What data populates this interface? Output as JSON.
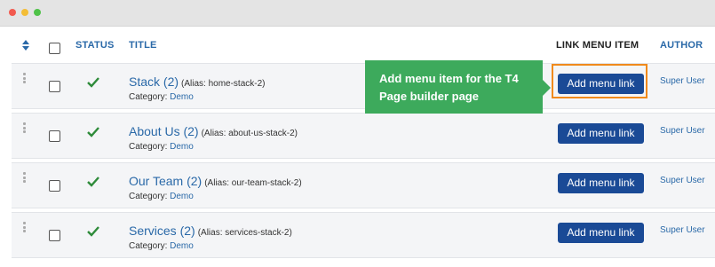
{
  "window": {
    "controls": [
      "close",
      "minimize",
      "maximize"
    ]
  },
  "table": {
    "headers": {
      "status": "STATUS",
      "title": "TITLE",
      "link_menu_item": "LINK MENU ITEM",
      "author": "AUTHOR"
    },
    "rows": [
      {
        "title": "Stack (2)",
        "alias": "(Alias: home-stack-2)",
        "category_label": "Category:",
        "category": "Demo",
        "button": "Add menu link",
        "author": "Super User",
        "status": "published"
      },
      {
        "title": "About Us (2)",
        "alias": "(Alias: about-us-stack-2)",
        "category_label": "Category:",
        "category": "Demo",
        "button": "Add menu link",
        "author": "Super User",
        "status": "published"
      },
      {
        "title": "Our Team (2)",
        "alias": "(Alias: our-team-stack-2)",
        "category_label": "Category:",
        "category": "Demo",
        "button": "Add menu link",
        "author": "Super User",
        "status": "published"
      },
      {
        "title": "Services (2)",
        "alias": "(Alias: services-stack-2)",
        "category_label": "Category:",
        "category": "Demo",
        "button": "Add menu link",
        "author": "Super User",
        "status": "published"
      }
    ]
  },
  "callout": {
    "line1": "Add menu item for the T4",
    "line2": "Page builder page"
  },
  "colors": {
    "link_blue": "#2a69a8",
    "button_blue": "#1a4a96",
    "callout_green": "#3daa5c",
    "highlight_orange": "#f08a1c",
    "check_green": "#2e8b3a"
  }
}
